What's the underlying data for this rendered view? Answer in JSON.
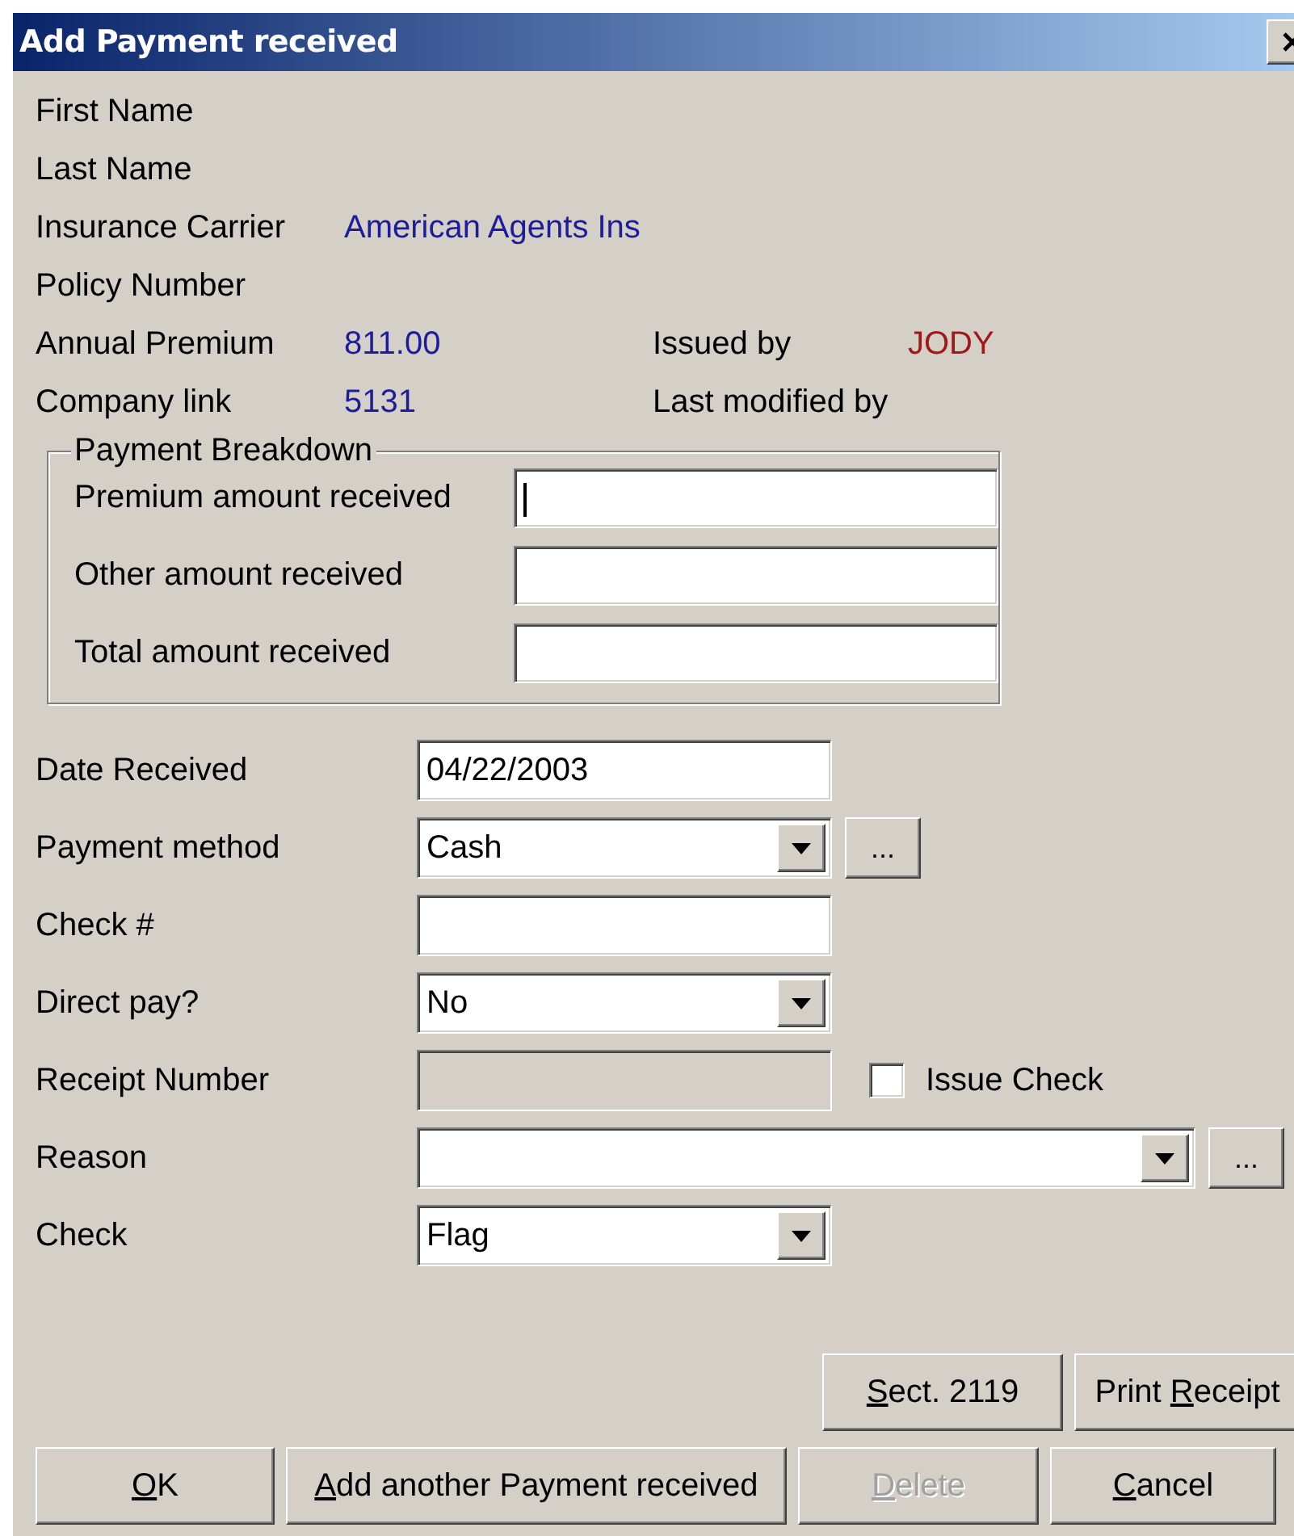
{
  "window": {
    "title": "Add Payment received"
  },
  "info": [
    {
      "label": "First Name"
    },
    {
      "label": "Last Name"
    },
    {
      "label": "Insurance Carrier",
      "value": "American Agents Ins"
    },
    {
      "label": "Policy Number"
    },
    {
      "label": "Annual Premium",
      "value": "811.00",
      "extra_label": "Issued by",
      "extra_value": "JODY"
    },
    {
      "label": "Company link",
      "value": "5131",
      "extra_label": "Last modified by"
    }
  ],
  "payment_breakdown": {
    "title": "Payment Breakdown",
    "fields": [
      {
        "label": "Premium amount received",
        "focused": true
      },
      {
        "label": "Other amount received",
        "focused": false
      },
      {
        "label": "Total amount received",
        "focused": false
      }
    ]
  },
  "fields": [
    {
      "kind": "text",
      "label": "Date Received",
      "value": "04/22/2003",
      "disabled": false
    },
    {
      "kind": "dropdown",
      "label": "Payment method",
      "value": "Cash",
      "disabled": false,
      "browse_button": "..."
    },
    {
      "kind": "text",
      "label": "Check #",
      "disabled": false
    },
    {
      "kind": "dropdown",
      "label": "Direct pay?",
      "value": "No",
      "disabled": false
    },
    {
      "kind": "text",
      "label": "Receipt Number",
      "disabled": true,
      "checkbox": {
        "label": "Issue Check",
        "checked": false
      }
    },
    {
      "kind": "wide-dropdown",
      "label": "Reason",
      "disabled": false,
      "browse_button": "..."
    },
    {
      "kind": "dropdown",
      "label": "Check",
      "value": "Flag",
      "disabled": false
    }
  ],
  "button_rows": [
    [
      {
        "key": "S",
        "after": "ect. 2119",
        "disabled": false
      },
      {
        "before": "Print ",
        "key": "R",
        "after": "eceipt",
        "disabled": false
      }
    ],
    [
      {
        "key": "O",
        "after": "K",
        "disabled": false
      },
      {
        "key": "A",
        "after": "dd another Payment received",
        "disabled": false
      },
      {
        "key": "D",
        "after": "elete",
        "disabled": true
      },
      {
        "key": "C",
        "after": "ancel",
        "disabled": false
      }
    ]
  ]
}
